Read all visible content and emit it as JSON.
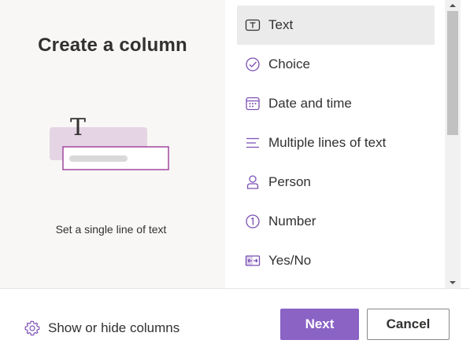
{
  "left": {
    "title": "Create a column",
    "description": "Set a single line of text",
    "illustration": {
      "glyph": "T",
      "icon": "text-field-illustration"
    }
  },
  "column_types": [
    {
      "label": "Text",
      "icon": "text-box-icon",
      "selected": true
    },
    {
      "label": "Choice",
      "icon": "check-circle-icon",
      "selected": false
    },
    {
      "label": "Date and time",
      "icon": "calendar-icon",
      "selected": false
    },
    {
      "label": "Multiple lines of text",
      "icon": "text-lines-icon",
      "selected": false
    },
    {
      "label": "Person",
      "icon": "person-icon",
      "selected": false
    },
    {
      "label": "Number",
      "icon": "number-circle-icon",
      "selected": false
    },
    {
      "label": "Yes/No",
      "icon": "toggle-yes-no-icon",
      "selected": false
    }
  ],
  "footer": {
    "show_hide_label": "Show or hide columns",
    "next_label": "Next",
    "cancel_label": "Cancel"
  },
  "colors": {
    "accent": "#8a63c5",
    "icon": "#7a4fb5",
    "left_panel_bg": "#f8f7f5",
    "selected_item_bg": "#ebebeb"
  }
}
